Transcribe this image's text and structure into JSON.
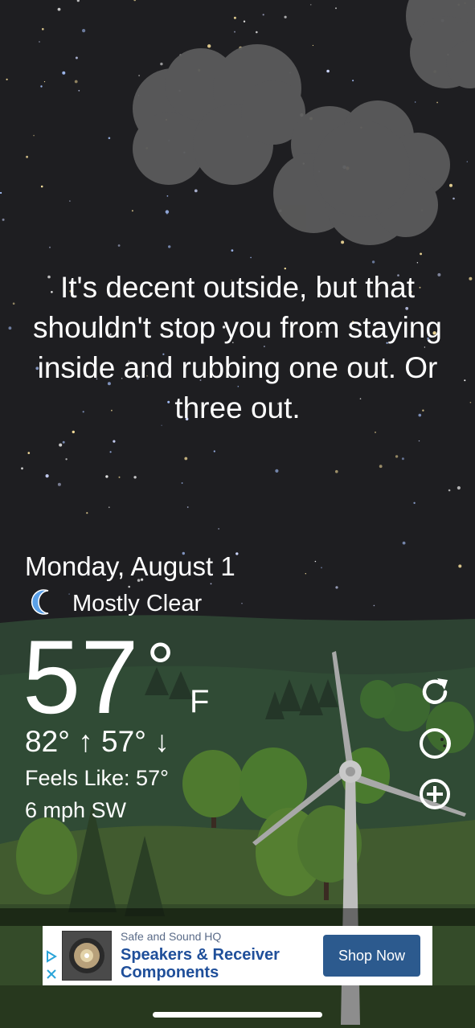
{
  "colors": {
    "sky": "#1e1e21",
    "cloud": "#5a5a5a",
    "hills_dark": "#2e4333",
    "grass": "#435e30",
    "ad_button": "#2c5a8e",
    "ad_title": "#1f4f9a",
    "moon": "#5aa0e8"
  },
  "message": "It's decent outside, but that shouldn't stop you from staying inside and rubbing one out. Or three out.",
  "weather": {
    "date": "Monday, August 1",
    "condition_icon": "crescent-moon-icon",
    "condition": "Mostly Clear",
    "temperature": "57",
    "degree_symbol": "°",
    "unit": "F",
    "hi_lo": "82° ↑ 57° ↓",
    "feels_like": "Feels Like: 57°",
    "wind": "6 mph SW"
  },
  "side_buttons": [
    {
      "icon": "refresh-icon"
    },
    {
      "icon": "moon-phase-icon"
    },
    {
      "icon": "add-circle-icon"
    }
  ],
  "ad": {
    "brand": "Safe and Sound HQ",
    "title": "Speakers & Receiver Components",
    "cta": "Shop Now",
    "choices_icon": "ad-choices-icon",
    "close_icon": "close-icon"
  }
}
